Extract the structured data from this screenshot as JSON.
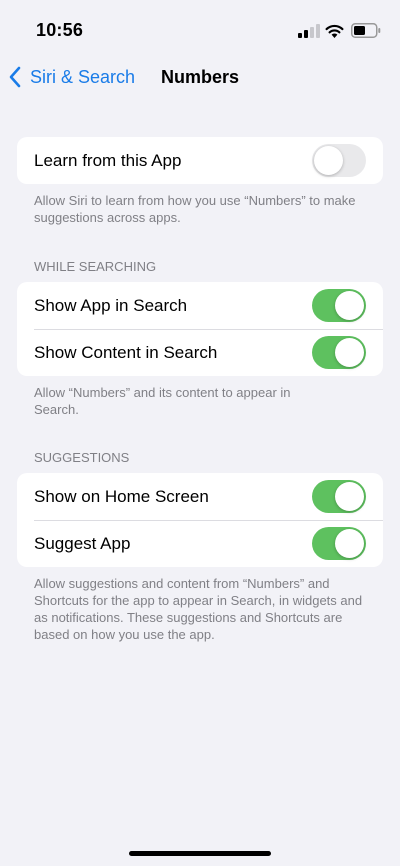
{
  "status_bar": {
    "time": "10:56"
  },
  "nav": {
    "back_label": "Siri & Search",
    "title": "Numbers"
  },
  "learn_group": {
    "row": {
      "label": "Learn from this App",
      "enabled": false
    },
    "footer": "Allow Siri to learn from how you use “Numbers” to make suggestions across apps."
  },
  "while_searching": {
    "header": "WHILE SEARCHING",
    "rows": [
      {
        "label": "Show App in Search",
        "enabled": true
      },
      {
        "label": "Show Content in Search",
        "enabled": true
      }
    ],
    "footer": "Allow “Numbers” and its content to appear in Search."
  },
  "suggestions": {
    "header": "SUGGESTIONS",
    "rows": [
      {
        "label": "Show on Home Screen",
        "enabled": true
      },
      {
        "label": "Suggest App",
        "enabled": true
      }
    ],
    "footer": "Allow suggestions and content from “Numbers” and Shortcuts for the app to appear in Search, in widgets and as notifications. These suggestions and Shortcuts are based on how you use the app."
  },
  "colors": {
    "accent": "#1a7ce8",
    "toggle_on": "#5ec15f",
    "toggle_off": "#e9e9eb",
    "background": "#f2f2f7"
  }
}
